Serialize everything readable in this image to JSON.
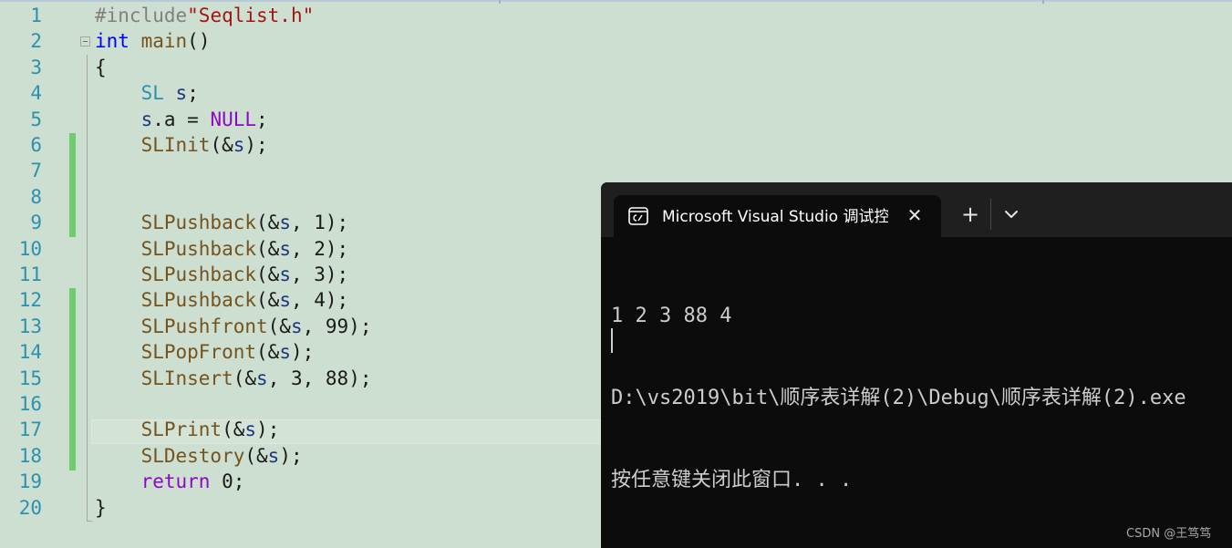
{
  "editor": {
    "lines": [
      {
        "n": "1",
        "tokens": [
          {
            "t": "#include",
            "c": "c-pp"
          },
          {
            "t": "\"Seqlist.h\"",
            "c": "c-str"
          }
        ]
      },
      {
        "n": "2",
        "tokens": [
          {
            "t": "int",
            "c": "c-kw"
          },
          {
            "t": " ",
            "c": ""
          },
          {
            "t": "main",
            "c": "c-fn"
          },
          {
            "t": "()",
            "c": ""
          }
        ]
      },
      {
        "n": "3",
        "tokens": [
          {
            "t": "{",
            "c": ""
          }
        ]
      },
      {
        "n": "4",
        "tokens": [
          {
            "t": "    ",
            "c": ""
          },
          {
            "t": "SL",
            "c": "c-ty"
          },
          {
            "t": " ",
            "c": ""
          },
          {
            "t": "s",
            "c": "c-var"
          },
          {
            "t": ";",
            "c": ""
          }
        ]
      },
      {
        "n": "5",
        "tokens": [
          {
            "t": "    ",
            "c": ""
          },
          {
            "t": "s",
            "c": "c-var"
          },
          {
            "t": ".a = ",
            "c": ""
          },
          {
            "t": "NULL",
            "c": "c-mac"
          },
          {
            "t": ";",
            "c": ""
          }
        ]
      },
      {
        "n": "6",
        "tokens": [
          {
            "t": "    ",
            "c": ""
          },
          {
            "t": "SLInit",
            "c": "c-fn"
          },
          {
            "t": "(&",
            "c": ""
          },
          {
            "t": "s",
            "c": "c-var"
          },
          {
            "t": ");",
            "c": ""
          }
        ]
      },
      {
        "n": "7",
        "tokens": []
      },
      {
        "n": "8",
        "tokens": []
      },
      {
        "n": "9",
        "tokens": [
          {
            "t": "    ",
            "c": ""
          },
          {
            "t": "SLPushback",
            "c": "c-fn"
          },
          {
            "t": "(&",
            "c": ""
          },
          {
            "t": "s",
            "c": "c-var"
          },
          {
            "t": ", 1);",
            "c": ""
          }
        ]
      },
      {
        "n": "10",
        "tokens": [
          {
            "t": "    ",
            "c": ""
          },
          {
            "t": "SLPushback",
            "c": "c-fn"
          },
          {
            "t": "(&",
            "c": ""
          },
          {
            "t": "s",
            "c": "c-var"
          },
          {
            "t": ", 2);",
            "c": ""
          }
        ]
      },
      {
        "n": "11",
        "tokens": [
          {
            "t": "    ",
            "c": ""
          },
          {
            "t": "SLPushback",
            "c": "c-fn"
          },
          {
            "t": "(&",
            "c": ""
          },
          {
            "t": "s",
            "c": "c-var"
          },
          {
            "t": ", 3);",
            "c": ""
          }
        ]
      },
      {
        "n": "12",
        "tokens": [
          {
            "t": "    ",
            "c": ""
          },
          {
            "t": "SLPushback",
            "c": "c-fn"
          },
          {
            "t": "(&",
            "c": ""
          },
          {
            "t": "s",
            "c": "c-var"
          },
          {
            "t": ", 4);",
            "c": ""
          }
        ]
      },
      {
        "n": "13",
        "tokens": [
          {
            "t": "    ",
            "c": ""
          },
          {
            "t": "SLPushfront",
            "c": "c-fn"
          },
          {
            "t": "(&",
            "c": ""
          },
          {
            "t": "s",
            "c": "c-var"
          },
          {
            "t": ", 99);",
            "c": ""
          }
        ]
      },
      {
        "n": "14",
        "tokens": [
          {
            "t": "    ",
            "c": ""
          },
          {
            "t": "SLPopFront",
            "c": "c-fn"
          },
          {
            "t": "(&",
            "c": ""
          },
          {
            "t": "s",
            "c": "c-var"
          },
          {
            "t": ");",
            "c": ""
          }
        ]
      },
      {
        "n": "15",
        "tokens": [
          {
            "t": "    ",
            "c": ""
          },
          {
            "t": "SLInsert",
            "c": "c-fn"
          },
          {
            "t": "(&",
            "c": ""
          },
          {
            "t": "s",
            "c": "c-var"
          },
          {
            "t": ", 3, 88);",
            "c": ""
          }
        ]
      },
      {
        "n": "16",
        "tokens": []
      },
      {
        "n": "17",
        "tokens": [
          {
            "t": "    ",
            "c": ""
          },
          {
            "t": "SLPrint",
            "c": "c-fn"
          },
          {
            "t": "(&",
            "c": ""
          },
          {
            "t": "s",
            "c": "c-var"
          },
          {
            "t": ");",
            "c": ""
          }
        ]
      },
      {
        "n": "18",
        "tokens": [
          {
            "t": "    ",
            "c": ""
          },
          {
            "t": "SLDestory",
            "c": "c-fn"
          },
          {
            "t": "(&",
            "c": ""
          },
          {
            "t": "s",
            "c": "c-var"
          },
          {
            "t": ");",
            "c": ""
          }
        ]
      },
      {
        "n": "19",
        "tokens": [
          {
            "t": "    ",
            "c": ""
          },
          {
            "t": "return",
            "c": "c-ctl"
          },
          {
            "t": " 0;",
            "c": ""
          }
        ]
      },
      {
        "n": "20",
        "tokens": [
          {
            "t": "}",
            "c": ""
          }
        ]
      }
    ],
    "changed_lines": [
      "6",
      "7",
      "8",
      "9",
      "12",
      "13",
      "14",
      "15",
      "16",
      "17",
      "18"
    ],
    "current_line": "17",
    "change_color": "#6fcc6f"
  },
  "terminal": {
    "tab_title": "Microsoft Visual Studio 调试控制台",
    "tab_icon": "console-icon",
    "close_glyph": "✕",
    "new_tab_glyph": "+",
    "dropdown_icon": "chevron-down-icon",
    "output_lines": [
      "1 2 3 88 4",
      "D:\\vs2019\\bit\\顺序表详解(2)\\Debug\\顺序表详解(2).exe",
      "按任意键关闭此窗口. . ."
    ],
    "background": "#0c0c0c"
  },
  "watermark": "CSDN @王笃笃"
}
